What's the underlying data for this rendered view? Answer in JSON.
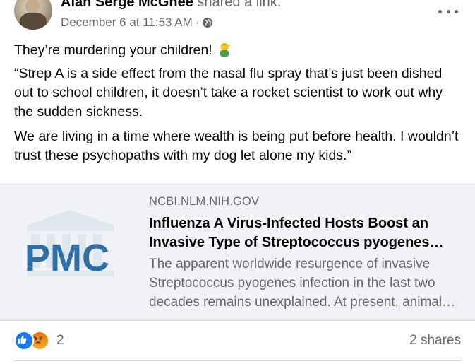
{
  "post": {
    "author": "Alan Serge McGhee",
    "action": " shared a link.",
    "timestamp": "December 6 at 11:53 AM",
    "separator": "·",
    "privacy_icon": "globe-icon",
    "more_icon": "more-options-icon",
    "text_line_1": "They’re murdering your children!",
    "text_line_1_emoji": "facepalm-emoji",
    "text_paragraph_2": "“Strep A is a side effect from the nasal flu spray that’s just been dished out to school children, it doesn’t take a rocket scientist to work out why the sudden sickness.",
    "text_paragraph_3": "We are living in a time where wealth is being put before health. I wouldn’t trust these psychopaths with my dog let alone my kids.”"
  },
  "link_preview": {
    "logo_text": "PMC",
    "domain": "NCBI.NLM.NIH.GOV",
    "title": "Influenza A Virus-Infected Hosts Boost an Invasive Type of Streptococcus pyogenes Infection in Mice",
    "description": "The apparent worldwide resurgence of invasive Streptococcus pyogenes infection in the last two decades remains unexplained. At present, animal models of"
  },
  "footer": {
    "reaction_icons": [
      "like-icon",
      "angry-icon"
    ],
    "reaction_count": "2",
    "shares": "2 shares"
  },
  "colors": {
    "secondary_text": "#65676b",
    "card_background": "#f0f2f5",
    "pmc_blue": "#2f6fa8",
    "like_blue": "#1877f2"
  }
}
